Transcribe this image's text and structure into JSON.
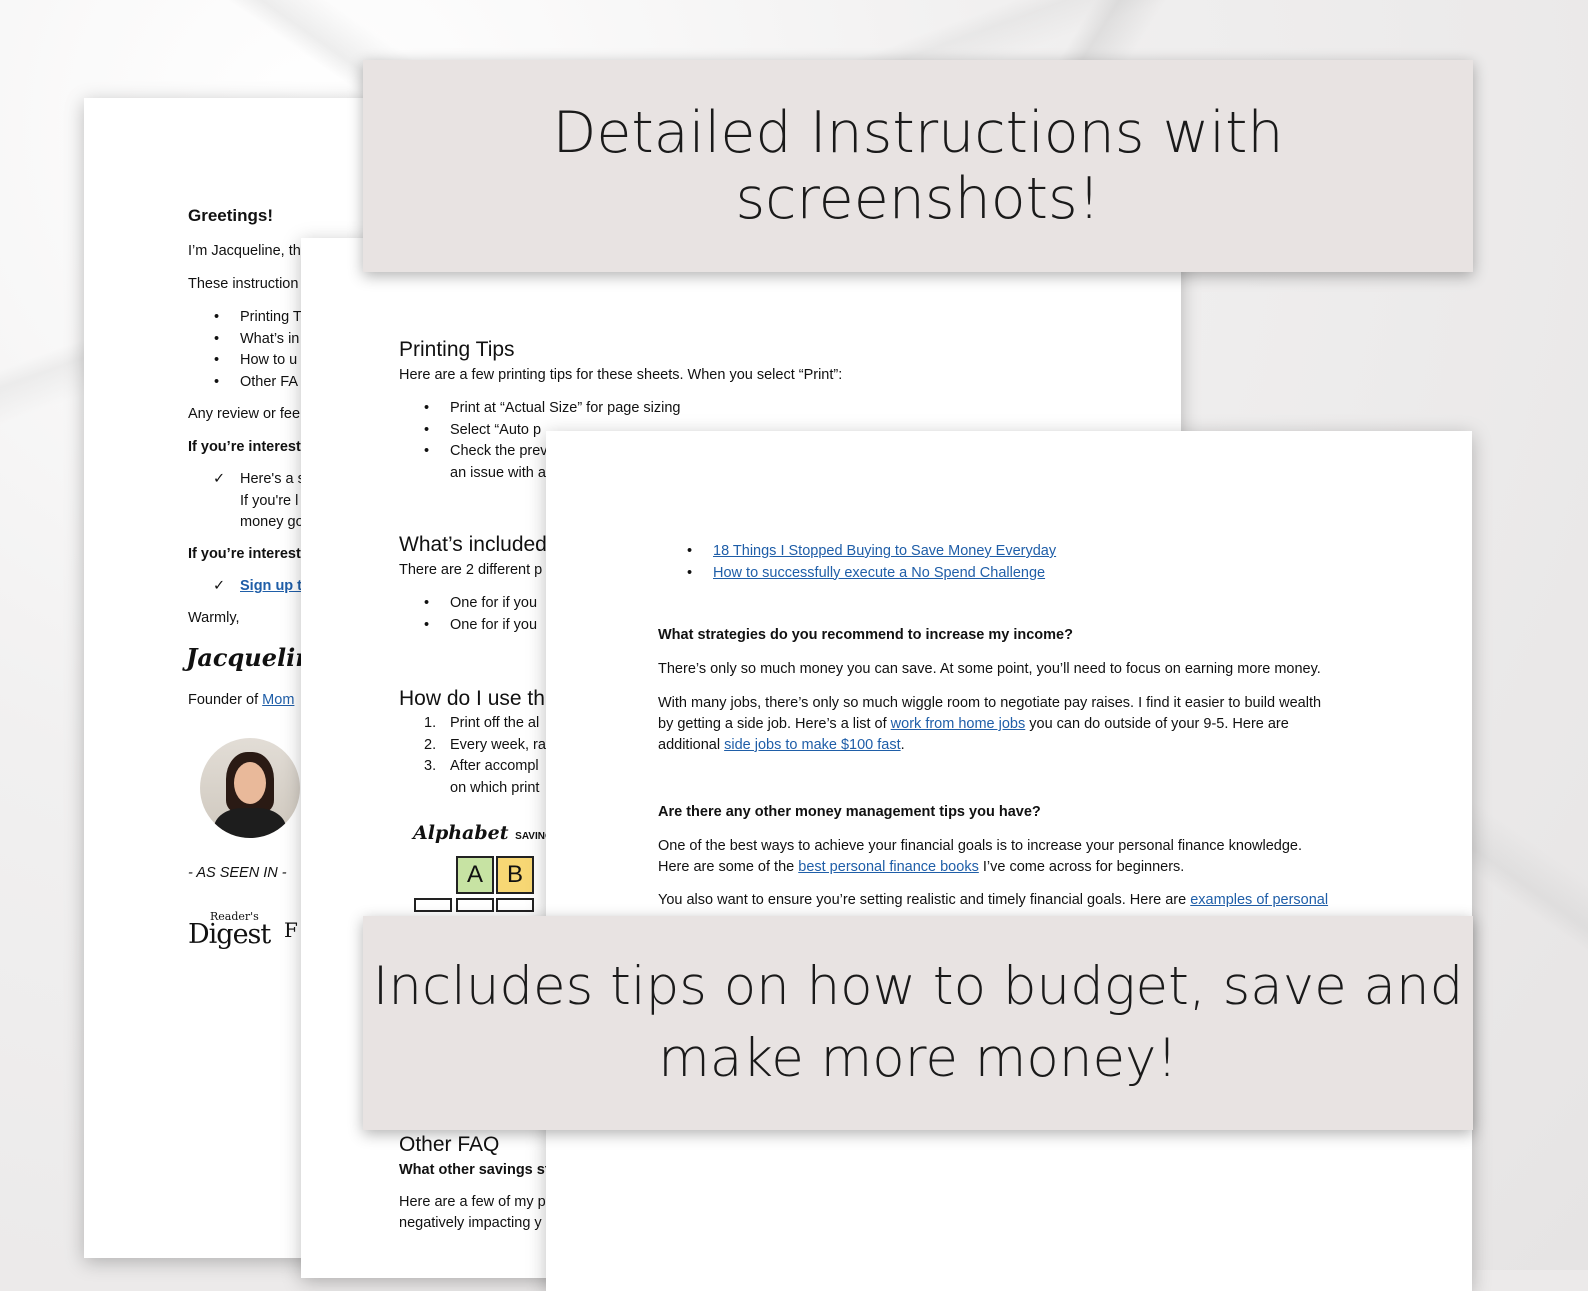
{
  "banners": {
    "top": "Detailed Instructions with screenshots!",
    "bottom_line1": "Includes tips on how to budget, save and",
    "bottom_line2": "make more money!"
  },
  "page1": {
    "greeting": "Greetings!",
    "intro": "I’m Jacqueline, th",
    "instructions_line": "These instruction",
    "bullets": [
      "Printing T",
      "What’s in",
      "How to u",
      "Other FA"
    ],
    "review_line": "Any review or fee",
    "interested_1": "If you’re interest",
    "check1_lines": [
      "Here's a s",
      "If you're l",
      "money go"
    ],
    "interested_2": "If you’re interest",
    "signup_link": "Sign up t",
    "warmly": "Warmly,",
    "signature": "Jacqueline",
    "founder_prefix": "Founder of ",
    "founder_link": "Mom",
    "as_seen_in": "- AS SEEN IN -",
    "logo_top": "Reader's",
    "logo_main": "Digest",
    "logo_second": "F"
  },
  "page2": {
    "printing_heading": "Printing Tips",
    "printing_intro": "Here are a few printing tips for these sheets. When you select “Print”:",
    "printing_bullets": [
      "Print at “Actual Size” for page sizing",
      "Select “Auto p",
      "Check the prev"
    ],
    "printing_bullet3_cont": "an issue with a",
    "included_heading": "What’s included",
    "included_intro": "There are 2 different p",
    "included_bullets": [
      "One for if you",
      "One for if you"
    ],
    "use_heading": "How do I use th",
    "use_steps": [
      "Print off the al",
      "Every week, ra",
      "After accompl"
    ],
    "use_numbers": [
      "1.",
      "2.",
      "3."
    ],
    "use_step3_cont": "on which print",
    "alphabet_title": "Alphabet",
    "alphabet_sub": "SAVINGS CH",
    "tiles": [
      {
        "letter": "A",
        "color": "#c7e3a3"
      },
      {
        "letter": "B",
        "color": "#f7d774"
      }
    ],
    "faq_heading": "Other FAQ",
    "faq_question": "What other savings st",
    "faq_answer_lines": [
      "Here are a few of my p",
      "negatively impacting y"
    ]
  },
  "page3": {
    "links": [
      "18 Things I Stopped Buying to Save Money Everyday",
      "How to successfully execute a No Spend Challenge"
    ],
    "q1": "What strategies do you recommend to increase my income?",
    "a1": "There’s only so much money you can save. At some point, you’ll need to focus on earning more money.",
    "p2_line1": "With many jobs, there’s only so much wiggle room to negotiate pay raises. I find it easier to build wealth",
    "p2_line2_a": "by getting a side job. Here’s a list of ",
    "p2_line2_link": "work from home jobs",
    "p2_line2_b": " you can do outside of your 9-5. Here are",
    "p2_line3_a": "additional ",
    "p2_line3_link": "side jobs to make $100 fast",
    "p2_line3_b": ".",
    "q2": "Are there any other money management tips you have?",
    "p3_line1": "One of the best ways to achieve your financial goals is to increase your personal finance knowledge.",
    "p3_line2_a": "Here are some of the ",
    "p3_line2_link": "best personal finance books",
    "p3_line2_b": " I’ve come across for beginners.",
    "p4_a": "You also want to ensure you’re setting realistic and timely financial goals. Here are ",
    "p4_link": "examples of personal"
  }
}
